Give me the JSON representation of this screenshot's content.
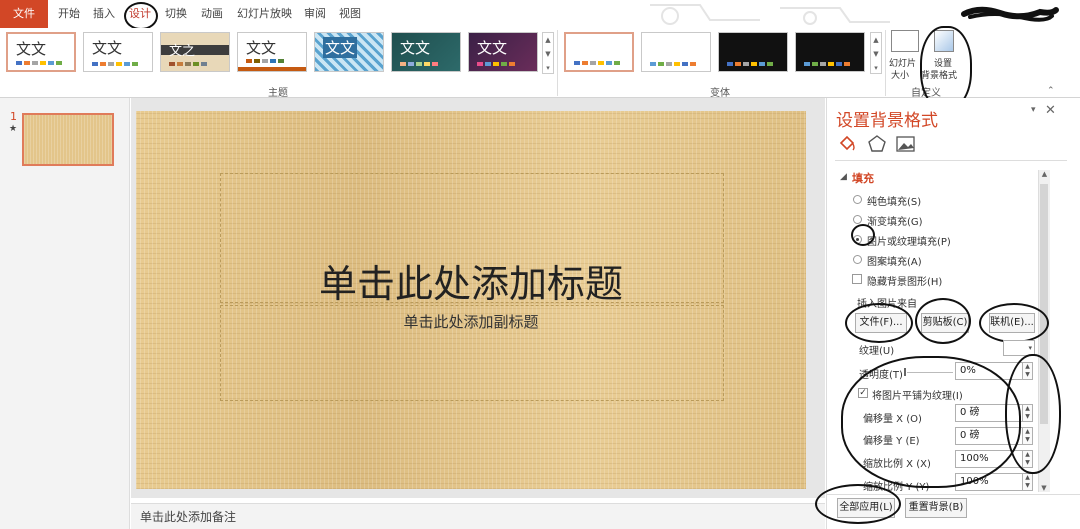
{
  "tabs": [
    "文件",
    "开始",
    "插入",
    "设计",
    "切换",
    "动画",
    "幻灯片放映",
    "审阅",
    "视图"
  ],
  "ribbon": {
    "theme_sample_text": "文文",
    "theme_sample_text_alt": "文之",
    "group_theme": "主题",
    "group_variant": "变体",
    "group_custom": "自定义",
    "slide_size_label_1": "幻灯片",
    "slide_size_label_2": "大小",
    "bg_format_label_1": "设置",
    "bg_format_label_2": "背景格式"
  },
  "thumbnail": {
    "number": "1",
    "star": "★"
  },
  "slide": {
    "title_placeholder": "单击此处添加标题",
    "subtitle_placeholder": "单击此处添加副标题"
  },
  "notes": "单击此处添加备注",
  "pane": {
    "title": "设置背景格式",
    "section_fill": "填充",
    "fill_solid": "纯色填充(S)",
    "fill_gradient": "渐变填充(G)",
    "fill_picture": "图片或纹理填充(P)",
    "fill_pattern": "图案填充(A)",
    "hide_bg": "隐藏背景图形(H)",
    "insert_from": "插入图片来自",
    "btn_file": "文件(F)...",
    "btn_clipboard": "剪贴板(C)",
    "btn_online": "联机(E)...",
    "texture": "纹理(U)",
    "transparency": "透明度(T)",
    "transparency_value": "0%",
    "tile": "将图片平铺为纹理(I)",
    "offset_x": "偏移量 X (O)",
    "offset_x_value": "0 磅",
    "offset_y": "偏移量 Y (E)",
    "offset_y_value": "0 磅",
    "scale_x": "缩放比例 X (X)",
    "scale_x_value": "100%",
    "scale_y": "缩放比例 Y (Y)",
    "scale_y_value": "100%",
    "apply_all": "全部应用(L)",
    "reset_bg": "重置背景(B)"
  },
  "colors": {
    "accent": "#d24726",
    "active_tab": "#c0392b",
    "pane_title": "#d24726"
  }
}
